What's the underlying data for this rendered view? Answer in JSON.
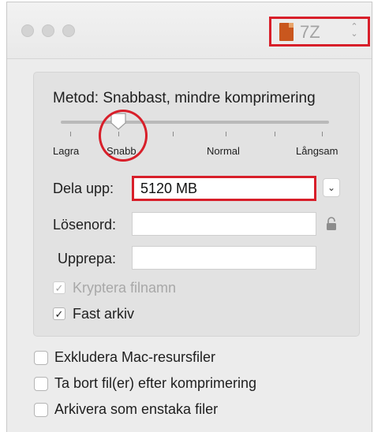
{
  "toolbar": {
    "format_value": "7Z",
    "highlight_color": "#d81f2a"
  },
  "compression": {
    "method_label": "Metod: Snabbast, mindre komprimering",
    "slider_level": 1,
    "slider_levels": 5,
    "tick_labels": [
      "Lagra",
      "Snabb",
      "Normal",
      "Långsam"
    ]
  },
  "split": {
    "label": "Dela upp:",
    "value": "5120 MB"
  },
  "password": {
    "label": "Lösenord:",
    "value": ""
  },
  "repeat": {
    "label": "Upprepa:",
    "value": ""
  },
  "options": {
    "encrypt_filenames": {
      "label": "Kryptera filnamn",
      "checked": true,
      "enabled": false
    },
    "solid_archive": {
      "label": "Fast arkiv",
      "checked": true,
      "enabled": true
    }
  },
  "extra_options": [
    {
      "label": "Exkludera Mac-resursfiler",
      "checked": false
    },
    {
      "label": "Ta bort fil(er) efter komprimering",
      "checked": false
    },
    {
      "label": "Arkivera som enstaka filer",
      "checked": false
    }
  ],
  "icons": {
    "check": "✓",
    "dropdown": "⌄",
    "lock": "lock-icon"
  }
}
